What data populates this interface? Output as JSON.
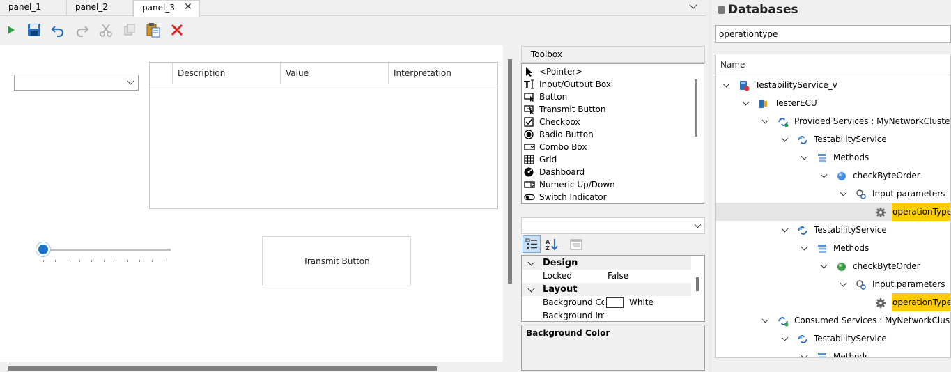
{
  "tabs": [
    {
      "label": "panel_1"
    },
    {
      "label": "panel_2"
    },
    {
      "label": "panel_3",
      "active": true
    }
  ],
  "tab_close_glyph": "✕",
  "designer": {
    "grid_columns": [
      "Description",
      "Value",
      "Interpretation"
    ],
    "slider_value_fraction": 0.0,
    "transmit_button_label": "Transmit Button"
  },
  "toolbox": {
    "title": "Toolbox",
    "items": [
      {
        "label": "<Pointer>",
        "icon": "pointer-icon"
      },
      {
        "label": "Input/Output Box",
        "icon": "text-io-icon"
      },
      {
        "label": "Button",
        "icon": "button-icon"
      },
      {
        "label": "Transmit Button",
        "icon": "transmit-button-icon"
      },
      {
        "label": "Checkbox",
        "icon": "checkbox-icon"
      },
      {
        "label": "Radio Button",
        "icon": "radio-icon"
      },
      {
        "label": "Combo Box",
        "icon": "combobox-icon"
      },
      {
        "label": "Grid",
        "icon": "grid-icon"
      },
      {
        "label": "Dashboard",
        "icon": "dashboard-icon"
      },
      {
        "label": "Numeric Up/Down",
        "icon": "numeric-updown-icon"
      },
      {
        "label": "Switch Indicator",
        "icon": "switch-icon"
      }
    ]
  },
  "properties": {
    "categories": [
      {
        "name": "Design",
        "rows": [
          {
            "name": "Locked",
            "value": "False"
          }
        ]
      },
      {
        "name": "Layout",
        "rows": [
          {
            "name": "Background Col",
            "value": "White",
            "swatch": "#ffffff"
          },
          {
            "name": "Background Ima",
            "value": ""
          }
        ]
      }
    ],
    "description_title": "Background Color"
  },
  "databases": {
    "title": "Databases",
    "search_value": "operationtype",
    "column_header": "Name",
    "nodes": [
      {
        "level": 0,
        "label": "TestabilityService_v",
        "icon": "database-icon"
      },
      {
        "level": 1,
        "label": "TesterECU",
        "icon": "ecu-icon"
      },
      {
        "level": 2,
        "label": "Provided Services : MyNetworkCluster",
        "icon": "services-icon"
      },
      {
        "level": 3,
        "label": "TestabilityService",
        "icon": "service-icon"
      },
      {
        "level": 4,
        "label": "Methods",
        "icon": "methods-icon"
      },
      {
        "level": 5,
        "label": "checkByteOrder",
        "icon": "method-blue-icon"
      },
      {
        "level": 6,
        "label": "Input parameters",
        "icon": "params-icon"
      },
      {
        "level": 7,
        "label": "operationType",
        "icon": "gear-icon",
        "highlight": true,
        "selected": true
      },
      {
        "level": 3,
        "label": "TestabilityService",
        "icon": "service-icon"
      },
      {
        "level": 4,
        "label": "Methods",
        "icon": "methods-icon"
      },
      {
        "level": 5,
        "label": "checkByteOrder",
        "icon": "method-green-icon"
      },
      {
        "level": 6,
        "label": "Input parameters",
        "icon": "params-icon"
      },
      {
        "level": 7,
        "label": "operationType",
        "icon": "gear-icon",
        "highlight": true
      },
      {
        "level": 2,
        "label": "Consumed Services : MyNetworkCluster",
        "icon": "services-icon"
      },
      {
        "level": 3,
        "label": "TestabilityService",
        "icon": "service-icon"
      },
      {
        "level": 4,
        "label": "Methods",
        "icon": "methods-icon"
      }
    ]
  },
  "colors": {
    "accent": "#1a73c9",
    "highlight": "#ffcc00",
    "delete": "#d9261c"
  }
}
